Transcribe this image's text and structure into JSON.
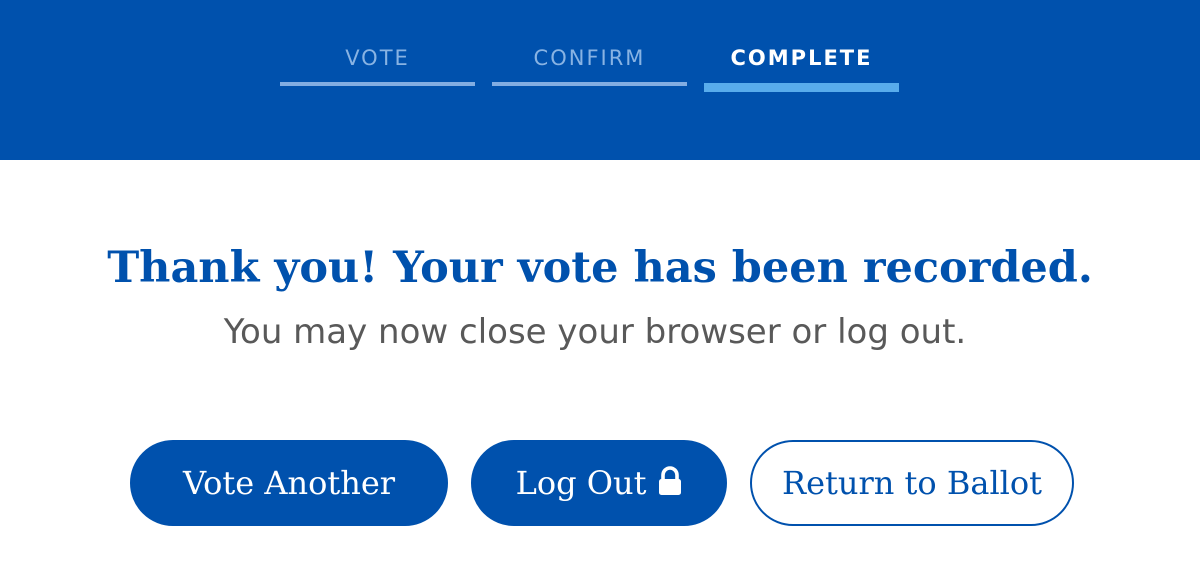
{
  "steps": [
    {
      "label": "VOTE",
      "state": "inactive"
    },
    {
      "label": "CONFIRM",
      "state": "inactive"
    },
    {
      "label": "COMPLETE",
      "state": "active"
    }
  ],
  "message": {
    "headline": "Thank you! Your vote has been recorded.",
    "subline": "You may now close your browser or log out."
  },
  "buttons": {
    "vote_another": "Vote Another",
    "log_out": "Log Out",
    "log_out_icon": "lock-icon",
    "return_to_ballot": "Return to Ballot"
  },
  "colors": {
    "brand_blue": "#0051ad",
    "active_step_bar": "#58acec",
    "inactive_step": "#88b3e3",
    "subtext": "#595959"
  }
}
